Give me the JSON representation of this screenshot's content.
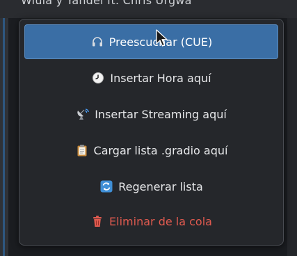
{
  "background": {
    "top_text": "Wiuia y Yandel ft. Chris Urgwa"
  },
  "menu": {
    "items": [
      {
        "label": "Preescuchar (CUE)",
        "icon": "headphones-icon",
        "state": "active"
      },
      {
        "label": "Insertar Hora aquí",
        "icon": "clock-icon"
      },
      {
        "label": "Insertar Streaming aquí",
        "icon": "satellite-antenna-icon"
      },
      {
        "label": "Cargar lista .gradio aquí",
        "icon": "clipboard-icon"
      },
      {
        "label": "Regenerar lista",
        "icon": "refresh-icon"
      },
      {
        "label": "Eliminar de la cola",
        "icon": "trash-icon",
        "state": "danger"
      }
    ]
  },
  "colors": {
    "active_item": "#3a6ea5",
    "danger_text": "#e05a4f",
    "menu_bg": "#25272b"
  }
}
